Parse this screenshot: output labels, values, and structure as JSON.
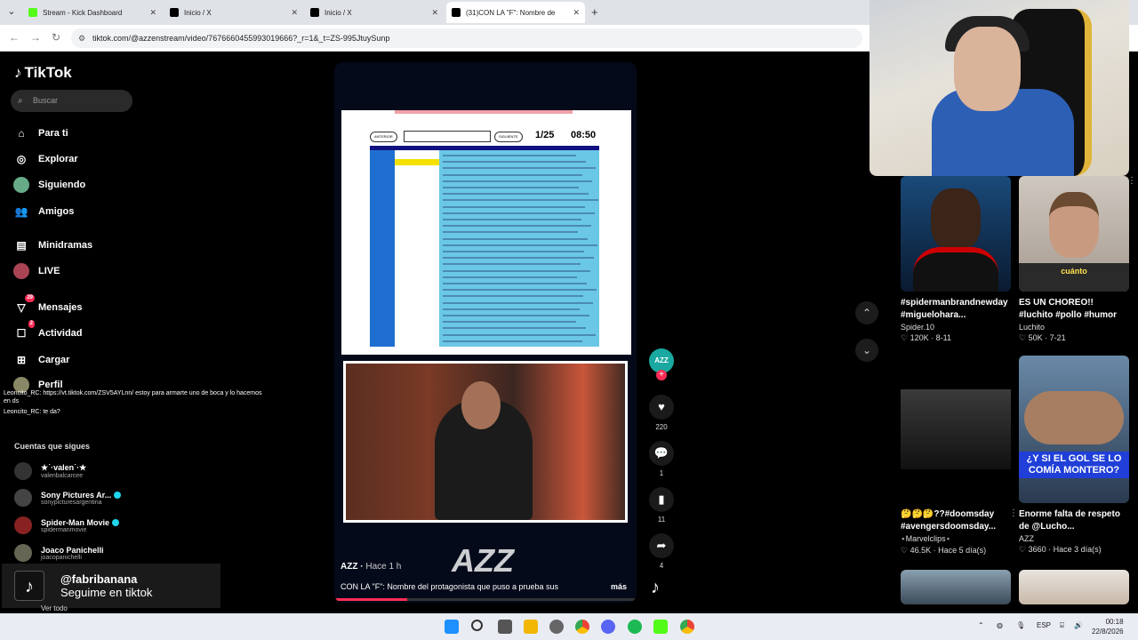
{
  "browser": {
    "tabs": [
      {
        "title": "Stream - Kick Dashboard",
        "color": "#53fc18"
      },
      {
        "title": "Inicio / X",
        "color": "#000000"
      },
      {
        "title": "Inicio / X",
        "color": "#000000"
      },
      {
        "title": "(31)CON LA \"F\": Nombre de",
        "color": "#000000"
      }
    ],
    "url": "tiktok.com/@azzenstream/video/7676660455993019666?_r=1&_t=ZS-995JtuySunp"
  },
  "sidebar": {
    "logo": "TikTok",
    "search_placeholder": "Buscar",
    "nav": [
      {
        "label": "Para ti",
        "icon": "home-icon"
      },
      {
        "label": "Explorar",
        "icon": "compass-icon"
      },
      {
        "label": "Siguiendo",
        "icon": "following-icon"
      },
      {
        "label": "Amigos",
        "icon": "friends-icon"
      },
      {
        "label": "Minidramas",
        "icon": "film-icon"
      },
      {
        "label": "LIVE",
        "icon": "live-icon"
      },
      {
        "label": "Mensajes",
        "icon": "messages-icon",
        "badge": "29"
      },
      {
        "label": "Actividad",
        "icon": "activity-icon",
        "badge": "2"
      },
      {
        "label": "Cargar",
        "icon": "upload-icon"
      },
      {
        "label": "Perfil",
        "icon": "profile-icon"
      }
    ],
    "chat": [
      "Leoncito_RC: https://vt.tiktok.com/ZSV5AYLnn/ estoy para armarte uno de boca y lo hacemos en ds",
      "Leoncito_RC: te da?"
    ],
    "following_title": "Cuentas que sigues",
    "following": [
      {
        "name": "★˙·valen˙·★",
        "handle": "valenbalcarcee",
        "verified": false
      },
      {
        "name": "Sony Pictures Ar...",
        "handle": "sonypicturesargentina",
        "verified": true
      },
      {
        "name": "Spider-Man Movie",
        "handle": "spidermanmovie",
        "verified": true
      },
      {
        "name": "Joaco Panichelli",
        "handle": "joacopanichelli",
        "verified": false
      }
    ],
    "overlay": {
      "handle": "@fabribanana",
      "text": "Seguime en tiktok"
    },
    "see_all": "Ver todo"
  },
  "video": {
    "sheet": {
      "prev": "ANTERIOR",
      "next": "SIGUIENTE",
      "counter": "1/25",
      "timer": "08:50"
    },
    "author": "AZZ",
    "time": "Hace 1 h",
    "caption": "CON LA \"F\": Nombre del protagonista que puso a prueba sus",
    "more": "más",
    "watermark": "AZZ",
    "progress": 0.24
  },
  "actions": {
    "avatar": "AZZ",
    "likes": "220",
    "comments": "1",
    "saves": "11",
    "shares": "4"
  },
  "recommendations": [
    {
      "desc": "#spidermanbrandnewday #miguelohara...",
      "author": "Spider.10",
      "views": "120K",
      "date": "8-11"
    },
    {
      "desc": "ES UN CHOREO!! #luchito #pollo #humor",
      "author": "Luchito",
      "views": "50K",
      "date": "7-21",
      "overlay": "cuánto"
    },
    {
      "desc": "🤔🤔🤔??#doomsday #avengersdoomsday...",
      "author": "⋆Marvelclips⋆",
      "views": "46.5K",
      "date": "Hace 5 día(s)"
    },
    {
      "desc": "Enorme falta de respeto de @Lucho...",
      "author": "AZZ",
      "views": "3660",
      "date": "Hace 3 día(s)",
      "overlay": "¿Y SI EL GOL SE LO COMÍA MONTERO?"
    }
  ],
  "tray": {
    "lang": "ESP",
    "time": "00:18",
    "date": "22/8/2026"
  }
}
